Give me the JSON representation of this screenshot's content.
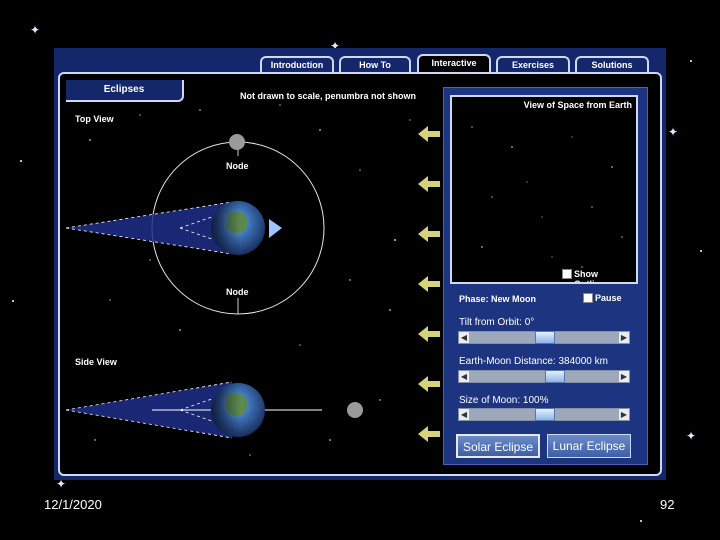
{
  "tabs": [
    {
      "label": "Introduction"
    },
    {
      "label": "How To"
    },
    {
      "label": "Interactive"
    },
    {
      "label": "Exercises"
    },
    {
      "label": "Solutions"
    }
  ],
  "active_tab": "Interactive",
  "section_tab": "Eclipses",
  "note": "Not drawn to scale, penumbra not shown",
  "top_view_label": "Top View",
  "side_view_label": "Side View",
  "node_top_label": "Node",
  "node_bottom_label": "Node",
  "space_view": {
    "title": "View of Space from Earth",
    "show_outlines_label": "Show Outlines",
    "show_outlines_checked": false
  },
  "controls": {
    "phase": "Phase: New Moon",
    "pause_label": "Pause",
    "pause_checked": false,
    "tilt_label": "Tilt from Orbit: 0°",
    "tilt_fraction": 0.5,
    "distance_label": "Earth-Moon Distance: 384000 km",
    "distance_fraction": 0.57,
    "size_label": "Size of Moon: 100%",
    "size_fraction": 0.5
  },
  "buttons": {
    "solar": "Solar Eclipse",
    "lunar": "Lunar Eclipse",
    "selected": "solar"
  },
  "footer": {
    "date": "12/1/2020",
    "page": "92"
  },
  "colors": {
    "panel_blue": "#14276a",
    "shadow_blue": "#1f2e8a",
    "arrow_yellow": "#d6d27a"
  }
}
